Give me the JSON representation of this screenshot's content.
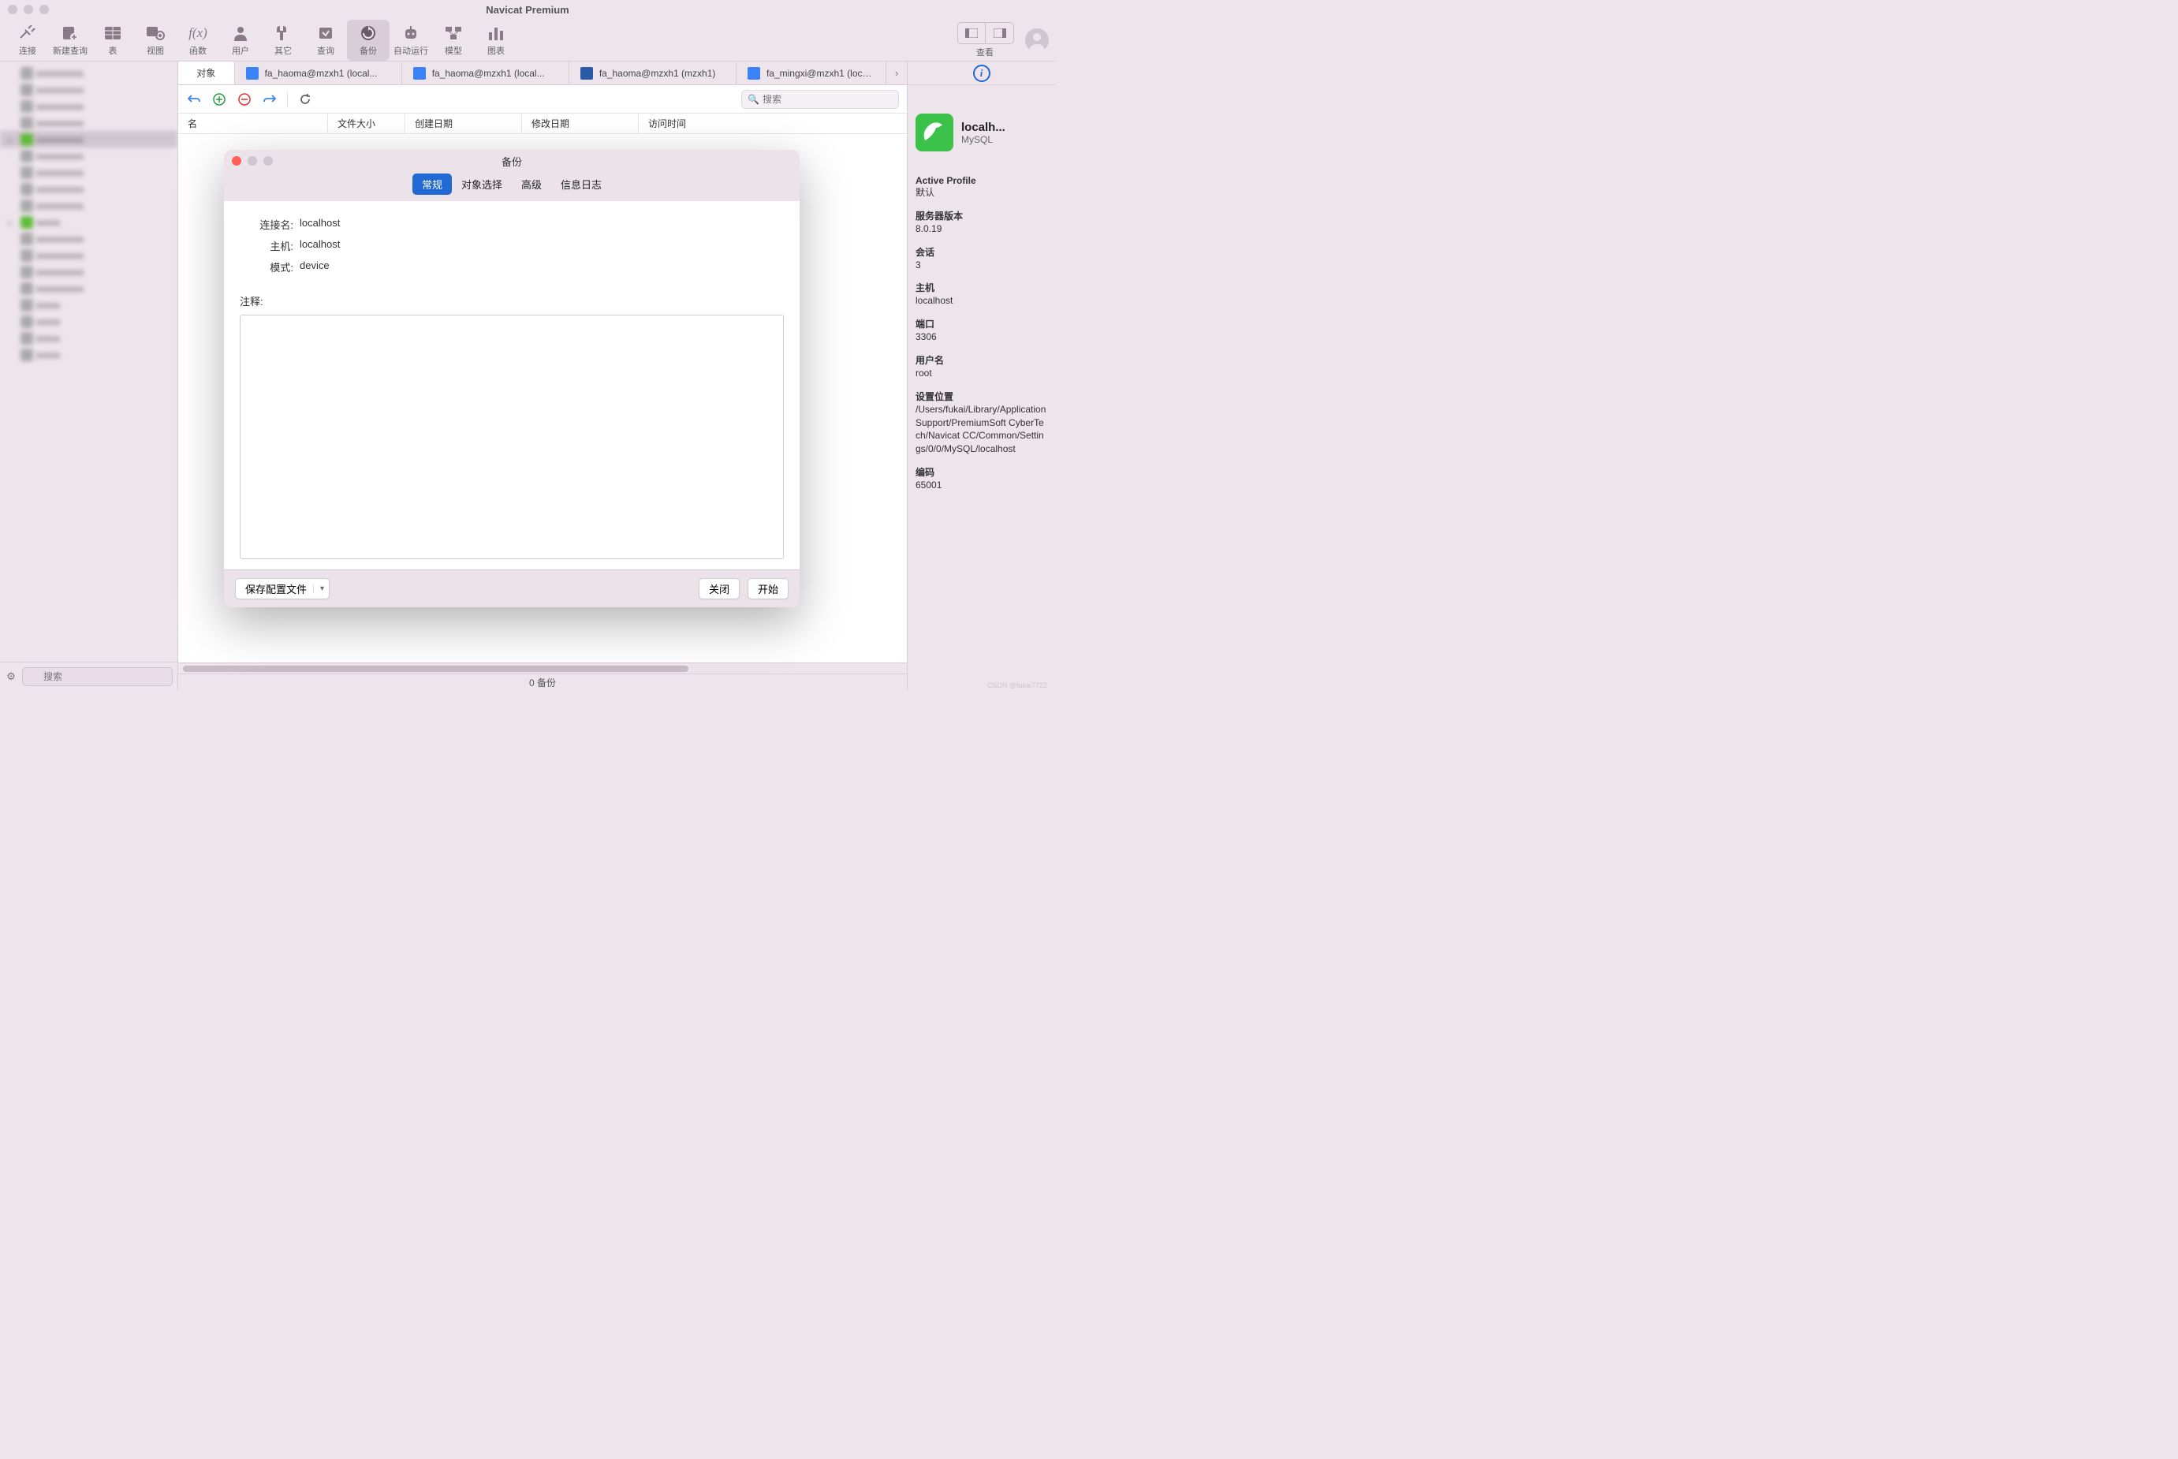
{
  "titlebar": {
    "title": "Navicat Premium"
  },
  "toolbar": {
    "items": [
      {
        "label": "连接"
      },
      {
        "label": "新建查询"
      },
      {
        "label": "表"
      },
      {
        "label": "视图"
      },
      {
        "label": "函数"
      },
      {
        "label": "用户"
      },
      {
        "label": "其它"
      },
      {
        "label": "查询"
      },
      {
        "label": "备份"
      },
      {
        "label": "自动运行"
      },
      {
        "label": "模型"
      },
      {
        "label": "图表"
      }
    ],
    "view_label": "查看"
  },
  "sidebar": {
    "search_placeholder": "搜索"
  },
  "content": {
    "tabs": [
      {
        "label": "对象"
      },
      {
        "label": "fa_haoma@mzxh1 (local..."
      },
      {
        "label": "fa_haoma@mzxh1 (local..."
      },
      {
        "label": "fa_haoma@mzxh1 (mzxh1)"
      },
      {
        "label": "fa_mingxi@mzxh1 (local..."
      }
    ],
    "search_placeholder": "搜索",
    "columns": [
      {
        "label": "名",
        "width": 190
      },
      {
        "label": "文件大小",
        "width": 98
      },
      {
        "label": "创建日期",
        "width": 148
      },
      {
        "label": "修改日期",
        "width": 148
      },
      {
        "label": "访问时间",
        "width": 148
      }
    ],
    "status": "0 备份"
  },
  "right": {
    "conn_name": "localh...",
    "conn_type": "MySQL",
    "info": [
      {
        "label": "Active Profile",
        "value": "默认"
      },
      {
        "label": "服务器版本",
        "value": "8.0.19"
      },
      {
        "label": "会话",
        "value": "3"
      },
      {
        "label": "主机",
        "value": "localhost"
      },
      {
        "label": "端口",
        "value": "3306"
      },
      {
        "label": "用户名",
        "value": "root"
      },
      {
        "label": "设置位置",
        "value": "/Users/fukai/Library/Application Support/PremiumSoft CyberTech/Navicat CC/Common/Settings/0/0/MySQL/localhost"
      },
      {
        "label": "编码",
        "value": "65001"
      }
    ]
  },
  "dialog": {
    "title": "备份",
    "tabs": [
      "常规",
      "对象选择",
      "高级",
      "信息日志"
    ],
    "form": {
      "conn_label": "连接名:",
      "conn_value": "localhost",
      "host_label": "主机:",
      "host_value": "localhost",
      "schema_label": "模式:",
      "schema_value": "device"
    },
    "comment_label": "注释:",
    "save_profile": "保存配置文件",
    "close": "关闭",
    "start": "开始"
  },
  "watermark": "CSDN @fukai7722"
}
